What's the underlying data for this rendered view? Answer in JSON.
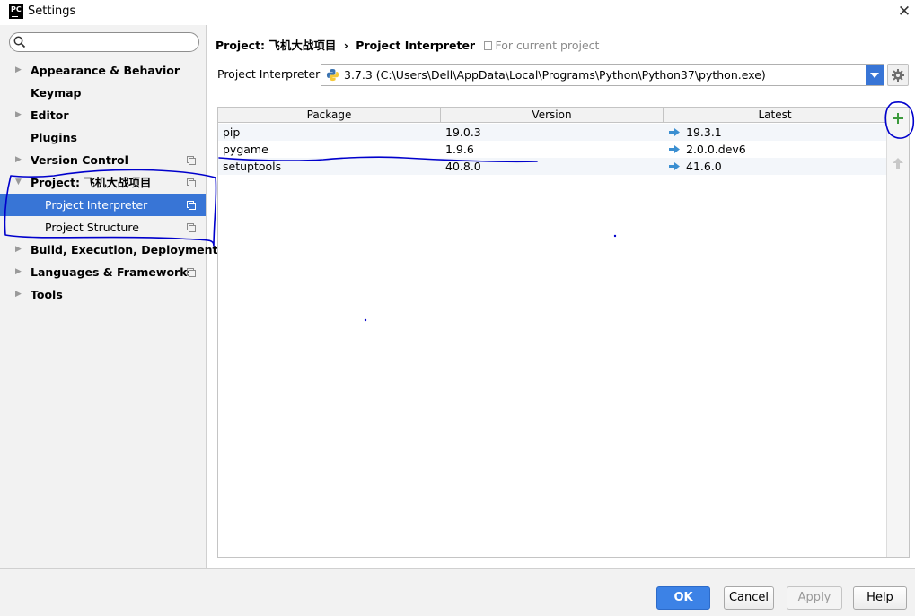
{
  "window": {
    "app_icon_text": "PC",
    "title": "Settings"
  },
  "sidebar": {
    "search_placeholder": "",
    "items": [
      {
        "label": "Appearance & Behavior"
      },
      {
        "label": "Keymap"
      },
      {
        "label": "Editor"
      },
      {
        "label": "Plugins"
      },
      {
        "label": "Version Control"
      },
      {
        "label": "Project: 飞机大战项目"
      },
      {
        "label": "Project Interpreter"
      },
      {
        "label": "Project Structure"
      },
      {
        "label": "Build, Execution, Deployment"
      },
      {
        "label": "Languages & Frameworks"
      },
      {
        "label": "Tools"
      }
    ]
  },
  "breadcrumb": {
    "project": "Project: 飞机大战项目",
    "separator": "›",
    "page": "Project Interpreter",
    "scope": "For current project"
  },
  "interpreter": {
    "label": "Project Interpreter:",
    "value": "3.7.3 (C:\\Users\\Dell\\AppData\\Local\\Programs\\Python\\Python37\\python.exe)"
  },
  "packages": {
    "columns": [
      "Package",
      "Version",
      "Latest"
    ],
    "rows": [
      {
        "package": "pip",
        "version": "19.0.3",
        "latest": "19.3.1"
      },
      {
        "package": "pygame",
        "version": "1.9.6",
        "latest": "2.0.0.dev6"
      },
      {
        "package": "setuptools",
        "version": "40.8.0",
        "latest": "41.6.0"
      }
    ]
  },
  "footer": {
    "ok": "OK",
    "cancel": "Cancel",
    "apply": "Apply",
    "help": "Help"
  },
  "colors": {
    "selection": "#3875d6",
    "annotation_ink": "#0000cc",
    "add_green": "#3c9a3c",
    "update_arrow": "#3b8fd1"
  }
}
